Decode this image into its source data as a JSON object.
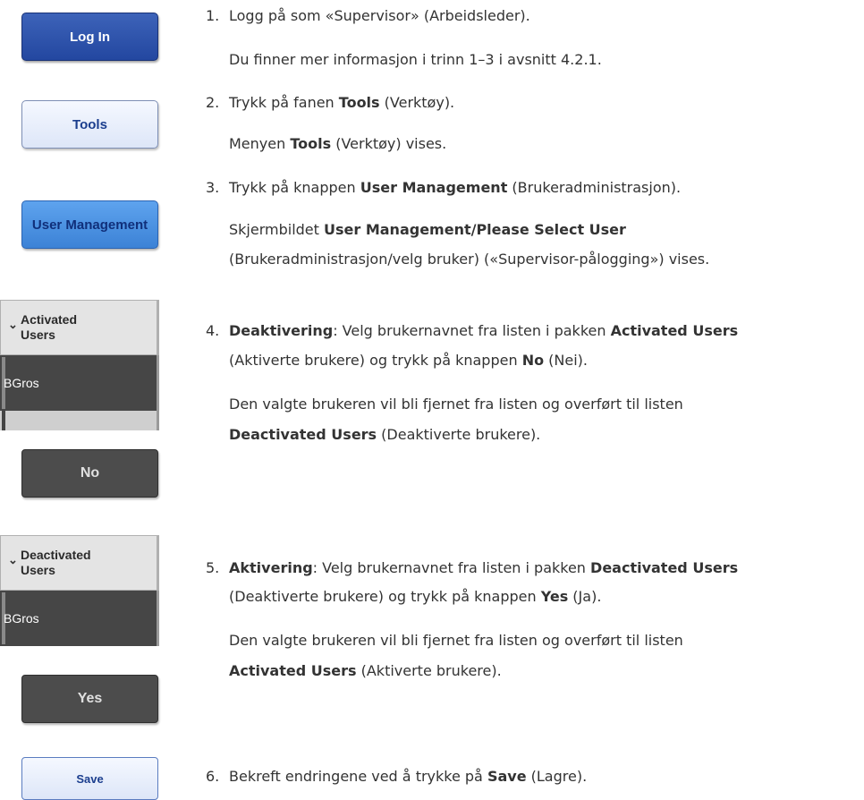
{
  "buttons": {
    "login": "Log In",
    "tools": "Tools",
    "user_management": "User Management",
    "no": "No",
    "yes": "Yes",
    "save": "Save"
  },
  "activated_panel": {
    "title_line1": "Activated",
    "title_line2": "Users",
    "user": "BGros"
  },
  "deactivated_panel": {
    "title_line1": "Deactivated",
    "title_line2": "Users",
    "user": "BGros"
  },
  "steps": {
    "s1": {
      "num": "1.",
      "text": "Logg på som «Supervisor» (Arbeidsleder).",
      "sub": "Du finner mer informasjon i trinn 1–3 i avsnitt 4.2.1."
    },
    "s2": {
      "num": "2.",
      "pre": "Trykk på fanen ",
      "bold": "Tools",
      "post": " (Verktøy).",
      "sub_pre": "Menyen ",
      "sub_bold": "Tools",
      "sub_post": " (Verktøy) vises."
    },
    "s3": {
      "num": "3.",
      "pre": "Trykk på knappen ",
      "bold": "User Management",
      "post": " (Brukeradministrasjon).",
      "sub1_pre": "Skjermbildet ",
      "sub1_bold": "User Management/Please Select User",
      "sub2": "(Brukeradministrasjon/velg bruker) («Supervisor-pålogging») vises."
    },
    "s4": {
      "num": "4.",
      "bold1": "Deaktivering",
      "mid": ": Velg brukernavnet fra listen i pakken ",
      "bold2": "Activated Users",
      "line2_pre": "(Aktiverte brukere) og trykk på knappen ",
      "line2_bold": "No",
      "line2_post": " (Nei).",
      "sub1": "Den valgte brukeren vil bli fjernet fra listen og overført til listen",
      "sub2_bold": "Deactivated Users",
      "sub2_post": " (Deaktiverte brukere)."
    },
    "s5": {
      "num": "5.",
      "bold1": "Aktivering",
      "mid": ": Velg brukernavnet fra listen i pakken ",
      "bold2": "Deactivated Users",
      "line2_pre": "(Deaktiverte brukere) og trykk på knappen ",
      "line2_bold": "Yes",
      "line2_post": " (Ja).",
      "sub1": "Den valgte brukeren vil bli fjernet fra listen og overført til listen",
      "sub2_bold": "Activated Users",
      "sub2_post": " (Aktiverte brukere)."
    },
    "s6": {
      "num": "6.",
      "pre": "Bekreft endringene ved å trykke på ",
      "bold": "Save",
      "post": " (Lagre)."
    }
  }
}
